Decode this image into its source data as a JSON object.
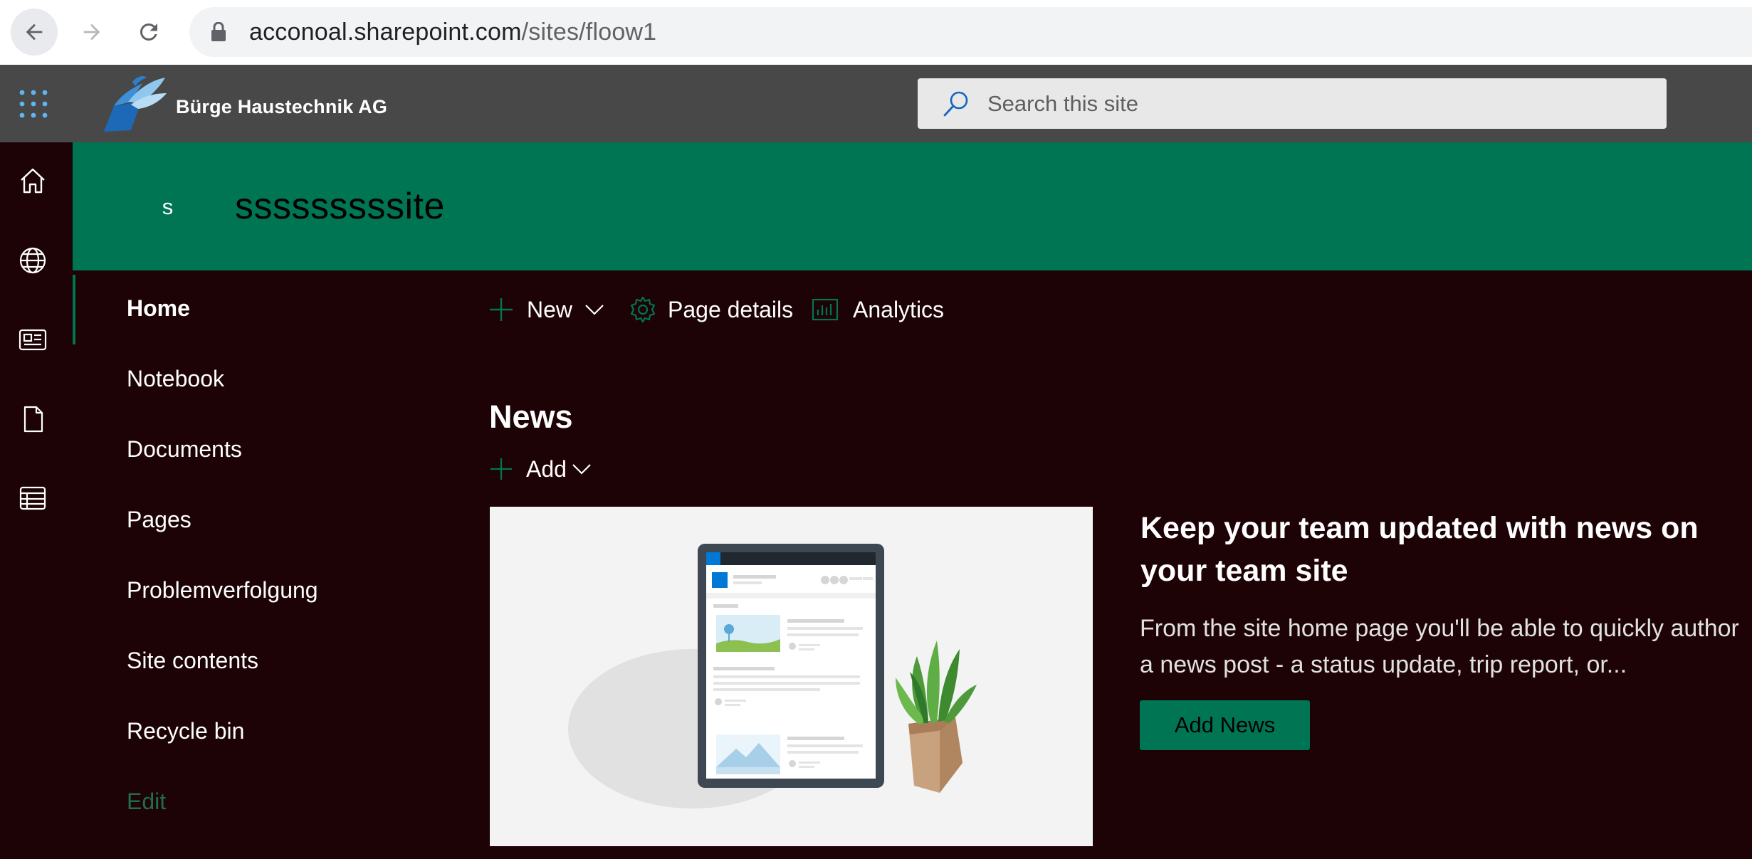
{
  "browser": {
    "url_host": "acconoal.sharepoint.com",
    "url_path": "/sites/floow1"
  },
  "suite": {
    "brand_name": "Bürge Haustechnik AG",
    "search_placeholder": "Search this site"
  },
  "app_bar": {
    "icons": [
      "home-icon",
      "globe-icon",
      "news-icon",
      "document-icon",
      "list-icon"
    ]
  },
  "site": {
    "logo_letter": "s",
    "title": "sssssssssite",
    "theme_color": "#007553"
  },
  "nav": {
    "items": [
      {
        "label": "Home",
        "active": true
      },
      {
        "label": "Notebook"
      },
      {
        "label": "Documents"
      },
      {
        "label": "Pages"
      },
      {
        "label": "Problemverfolgung"
      },
      {
        "label": "Site contents"
      },
      {
        "label": "Recycle bin"
      }
    ],
    "edit_label": "Edit"
  },
  "command_bar": {
    "new_label": "New",
    "page_details_label": "Page details",
    "analytics_label": "Analytics"
  },
  "news": {
    "section_title": "News",
    "add_label": "Add",
    "headline": "Keep your team updated with news on your team site",
    "body": "From the site home page you'll be able to quickly author a news post - a status update, trip report, or...",
    "button_label": "Add News"
  }
}
